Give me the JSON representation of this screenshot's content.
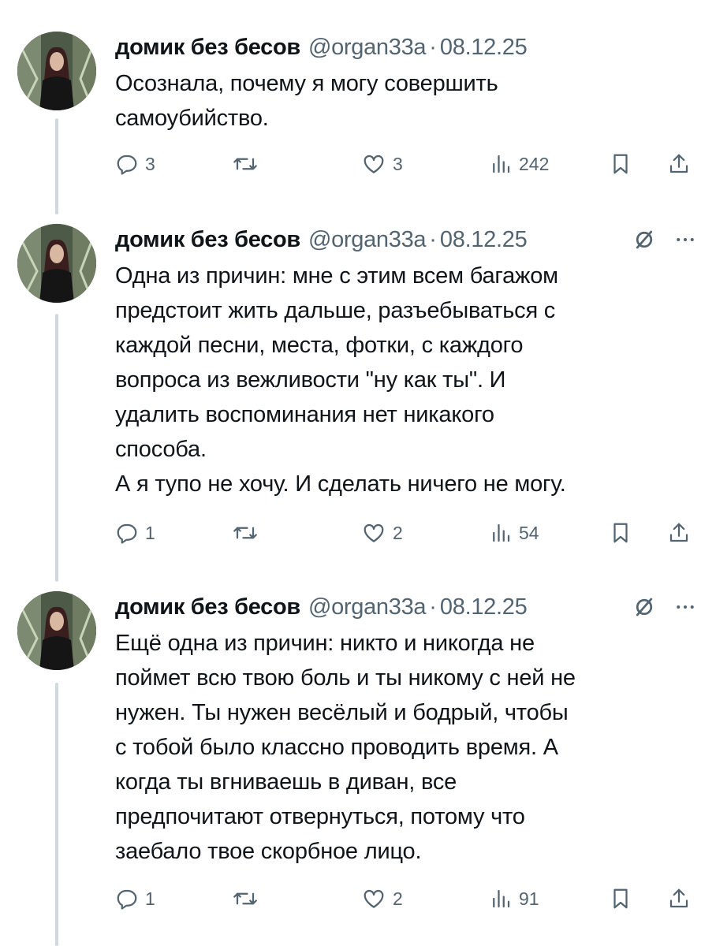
{
  "author": {
    "name": "домик без бесов",
    "handle": "@organ33a"
  },
  "separator": "·",
  "tweets": [
    {
      "date": "08.12.25",
      "text": "Осознала, почему я могу совершить\nсамоубийство.",
      "replies": "3",
      "likes": "3",
      "views": "242",
      "show_header_icons": false
    },
    {
      "date": "08.12.25",
      "text": "Одна из причин: мне с этим всем багажом\nпредстоит жить дальше, разъебываться с\nкаждой песни, места, фотки, с каждого\nвопроса из вежливости \"ну как ты\". И\nудалить воспоминания нет никакого\nспособа.\nА я тупо не хочу. И сделать ничего не могу.",
      "replies": "1",
      "likes": "2",
      "views": "54",
      "show_header_icons": true
    },
    {
      "date": "08.12.25",
      "text": "Ещё одна из причин: никто и никогда не\nпоймет всю твою боль и ты никому с ней не\nнужен. Ты нужен весёлый и бодрый, чтобы\nс тобой было классно проводить время. А\nкогда ты вгниваешь в диван, все\nпредпочитают отвернуться, потому что\nзаебало твое скорбное лицо.",
      "replies": "1",
      "likes": "2",
      "views": "91",
      "show_header_icons": true
    }
  ],
  "icons": {
    "reply": "reply-icon",
    "repost": "repost-icon",
    "like": "like-icon",
    "views": "views-icon",
    "bookmark": "bookmark-icon",
    "share": "share-icon",
    "grok": "grok-icon",
    "more": "more-icon"
  },
  "colors": {
    "text": "#0f1419",
    "secondary": "#536471",
    "thread_line": "#cfd9de"
  }
}
